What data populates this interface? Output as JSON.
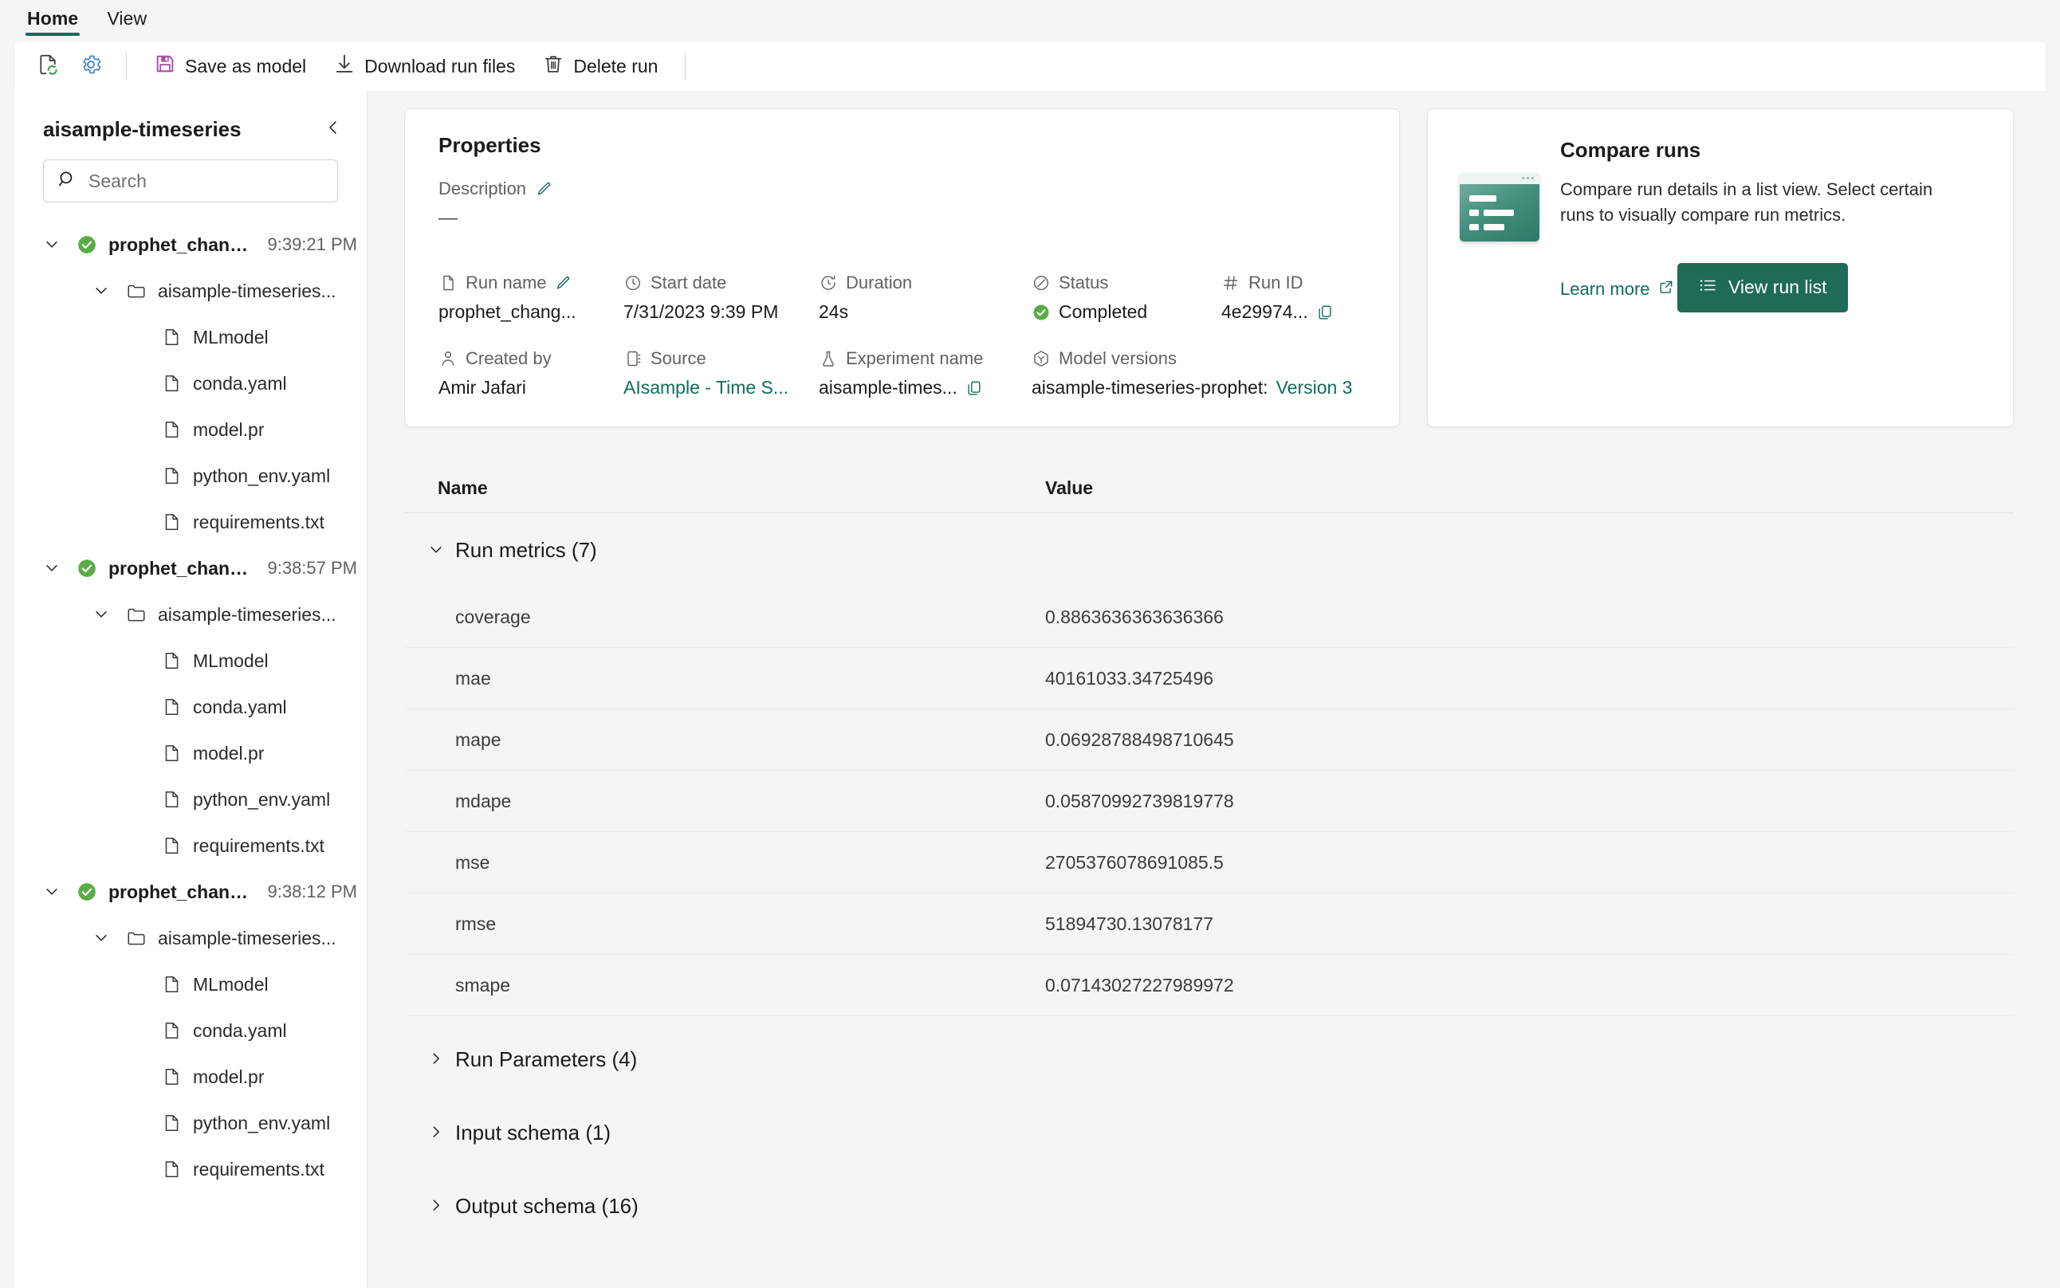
{
  "ribbon": {
    "tabs": [
      {
        "label": "Home",
        "active": true
      },
      {
        "label": "View",
        "active": false
      }
    ],
    "commands": {
      "refresh_icon": "refresh-document-icon",
      "settings_icon": "gear-icon",
      "save_as_model": "Save as model",
      "download_run_files": "Download run files",
      "delete_run": "Delete run"
    }
  },
  "sidebar": {
    "title": "aisample-timeseries",
    "collapse_icon": "chevron-left-icon",
    "search": {
      "placeholder": "Search",
      "value": "",
      "icon": "search-icon"
    },
    "tree": [
      {
        "type": "run",
        "label": "prophet_chang...",
        "time": "9:39:21 PM",
        "status_icon": "success-check-icon",
        "expanded": true,
        "children": [
          {
            "type": "folder",
            "label": "aisample-timeseries...",
            "expanded": true,
            "children": [
              {
                "type": "file",
                "label": "MLmodel"
              },
              {
                "type": "file",
                "label": "conda.yaml"
              },
              {
                "type": "file",
                "label": "model.pr"
              },
              {
                "type": "file",
                "label": "python_env.yaml"
              },
              {
                "type": "file",
                "label": "requirements.txt"
              }
            ]
          }
        ]
      },
      {
        "type": "run",
        "label": "prophet_chang...",
        "time": "9:38:57 PM",
        "status_icon": "success-check-icon",
        "expanded": true,
        "children": [
          {
            "type": "folder",
            "label": "aisample-timeseries...",
            "expanded": true,
            "children": [
              {
                "type": "file",
                "label": "MLmodel"
              },
              {
                "type": "file",
                "label": "conda.yaml"
              },
              {
                "type": "file",
                "label": "model.pr"
              },
              {
                "type": "file",
                "label": "python_env.yaml"
              },
              {
                "type": "file",
                "label": "requirements.txt"
              }
            ]
          }
        ]
      },
      {
        "type": "run",
        "label": "prophet_chang...",
        "time": "9:38:12 PM",
        "status_icon": "success-check-icon",
        "expanded": true,
        "children": [
          {
            "type": "folder",
            "label": "aisample-timeseries...",
            "expanded": true,
            "children": [
              {
                "type": "file",
                "label": "MLmodel"
              },
              {
                "type": "file",
                "label": "conda.yaml"
              },
              {
                "type": "file",
                "label": "model.pr"
              },
              {
                "type": "file",
                "label": "python_env.yaml"
              },
              {
                "type": "file",
                "label": "requirements.txt"
              }
            ]
          }
        ]
      }
    ]
  },
  "properties": {
    "title": "Properties",
    "description_label": "Description",
    "description_value": "—",
    "fields": [
      {
        "icon": "document-icon",
        "label": "Run name",
        "value": "prophet_chang...",
        "editable": true
      },
      {
        "icon": "clock-icon",
        "label": "Start date",
        "value": "7/31/2023 9:39 PM"
      },
      {
        "icon": "duration-icon",
        "label": "Duration",
        "value": "24s"
      },
      {
        "icon": "status-icon",
        "label": "Status",
        "value": "Completed",
        "status": "success"
      },
      {
        "icon": "hash-icon",
        "label": "Run ID",
        "value": "4e29974...",
        "copyable": true
      },
      {
        "icon": "person-icon",
        "label": "Created by",
        "value": "Amir Jafari"
      },
      {
        "icon": "notebook-icon",
        "label": "Source",
        "value": "AIsample - Time S...",
        "link": true
      },
      {
        "icon": "experiment-icon",
        "label": "Experiment name",
        "value": "aisample-times...",
        "copyable": true
      },
      {
        "icon": "model-icon",
        "label": "Model versions",
        "value": "aisample-timeseries-prophet:",
        "link_suffix": "Version 3"
      }
    ]
  },
  "compare_card": {
    "title": "Compare runs",
    "description": "Compare run details in a list view. Select certain runs to visually compare run metrics.",
    "learn_more": "Learn more",
    "learn_more_icon": "open-in-new-icon",
    "button_label": "View run list",
    "button_icon": "list-icon",
    "accent_color": "#1f6b57"
  },
  "table": {
    "headers": {
      "name": "Name",
      "value": "Value"
    },
    "sections": [
      {
        "label": "Run metrics (7)",
        "expanded": true,
        "rows": [
          {
            "name": "coverage",
            "value": "0.8863636363636366"
          },
          {
            "name": "mae",
            "value": "40161033.34725496"
          },
          {
            "name": "mape",
            "value": "0.06928788498710645"
          },
          {
            "name": "mdape",
            "value": "0.05870992739819778"
          },
          {
            "name": "mse",
            "value": "2705376078691085.5"
          },
          {
            "name": "rmse",
            "value": "51894730.13078177"
          },
          {
            "name": "smape",
            "value": "0.07143027227989972"
          }
        ]
      },
      {
        "label": "Run Parameters (4)",
        "expanded": false,
        "rows": []
      },
      {
        "label": "Input schema (1)",
        "expanded": false,
        "rows": []
      },
      {
        "label": "Output schema (16)",
        "expanded": false,
        "rows": []
      }
    ]
  }
}
